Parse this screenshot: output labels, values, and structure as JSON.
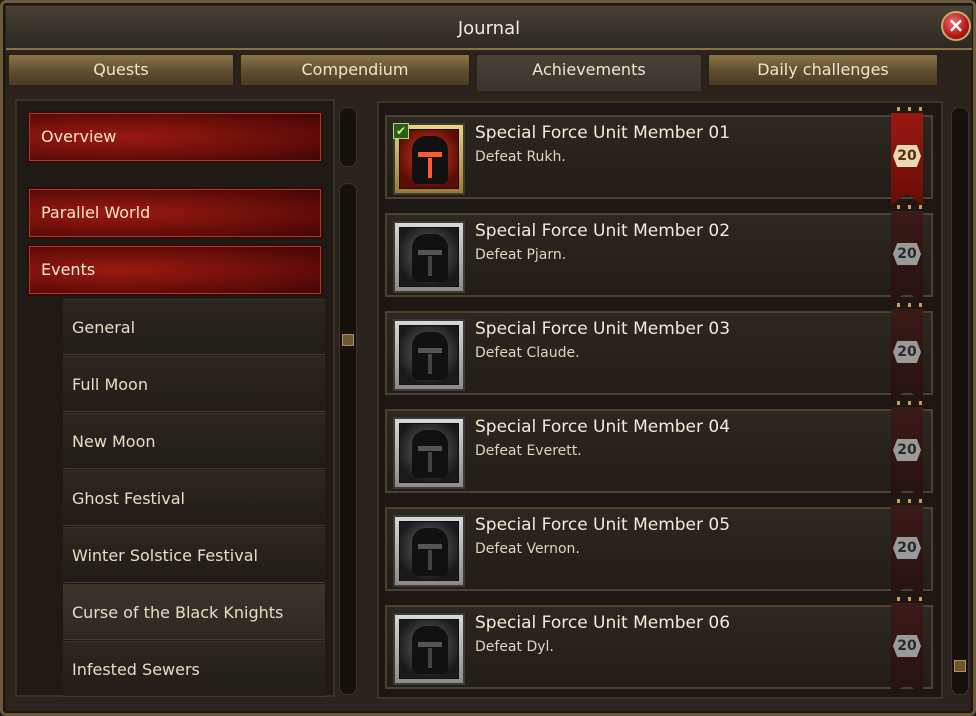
{
  "window": {
    "title": "Journal",
    "close_icon": "close-x-icon"
  },
  "tabs": [
    {
      "label": "Quests",
      "active": false
    },
    {
      "label": "Compendium",
      "active": false
    },
    {
      "label": "Achievements",
      "active": true
    },
    {
      "label": "Daily  challenges",
      "active": false
    }
  ],
  "sidebar": {
    "top": {
      "label": "Overview"
    },
    "categories": [
      {
        "label": "Parallel  World"
      },
      {
        "label": "Events"
      }
    ],
    "subitems": [
      {
        "label": "General"
      },
      {
        "label": "Full  Moon"
      },
      {
        "label": "New  Moon"
      },
      {
        "label": "Ghost  Festival"
      },
      {
        "label": "Winter  Solstice  Festival"
      },
      {
        "label": "Curse  of  the  Black  Knights",
        "selected": true
      },
      {
        "label": "Infested  Sewers"
      }
    ]
  },
  "achievements": [
    {
      "title": "Special  Force  Unit  Member  01",
      "desc": "Defeat  Rukh.",
      "points": "20",
      "completed": true
    },
    {
      "title": "Special  Force  Unit  Member  02",
      "desc": "Defeat  Pjarn.",
      "points": "20",
      "completed": false
    },
    {
      "title": "Special  Force  Unit  Member  03",
      "desc": "Defeat  Claude.",
      "points": "20",
      "completed": false
    },
    {
      "title": "Special  Force  Unit  Member  04",
      "desc": "Defeat  Everett.",
      "points": "20",
      "completed": false
    },
    {
      "title": "Special  Force  Unit  Member  05",
      "desc": "Defeat  Vernon.",
      "points": "20",
      "completed": false
    },
    {
      "title": "Special  Force  Unit  Member  06",
      "desc": "Defeat  Dyl.",
      "points": "20",
      "completed": false
    }
  ],
  "colors": {
    "accent_red": "#9a1a10",
    "gold_trim": "#c8a048",
    "panel_dark": "#1d1813"
  }
}
